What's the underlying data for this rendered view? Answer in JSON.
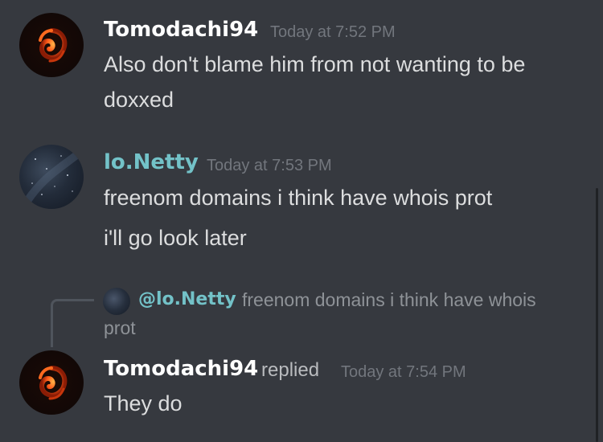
{
  "colors": {
    "background": "#36393f",
    "username_default": "#ffffff",
    "username_lonetty": "#73c2c8",
    "timestamp": "#72767d",
    "message_text": "#dcddde"
  },
  "messages": [
    {
      "author": "Tomodachi94",
      "avatar_icon": "fire-swirl-avatar",
      "timestamp": "Today at 7:52 PM",
      "lines": [
        "Also don't blame him from not wanting to be",
        "doxxed"
      ]
    },
    {
      "author": "lo.Netty",
      "avatar_icon": "starry-sky-avatar",
      "timestamp": "Today at 7:53 PM",
      "lines": [
        "freenom domains i think have whois prot",
        "i'll go look later"
      ]
    },
    {
      "author": "Tomodachi94",
      "replied_label": "replied",
      "avatar_icon": "fire-swirl-avatar",
      "timestamp": "Today at 7:54 PM",
      "reply": {
        "mention": "@lo.Netty",
        "preview_line1": "freenom domains i think have whois",
        "preview_line2": "prot"
      },
      "lines": [
        "They do"
      ]
    }
  ]
}
